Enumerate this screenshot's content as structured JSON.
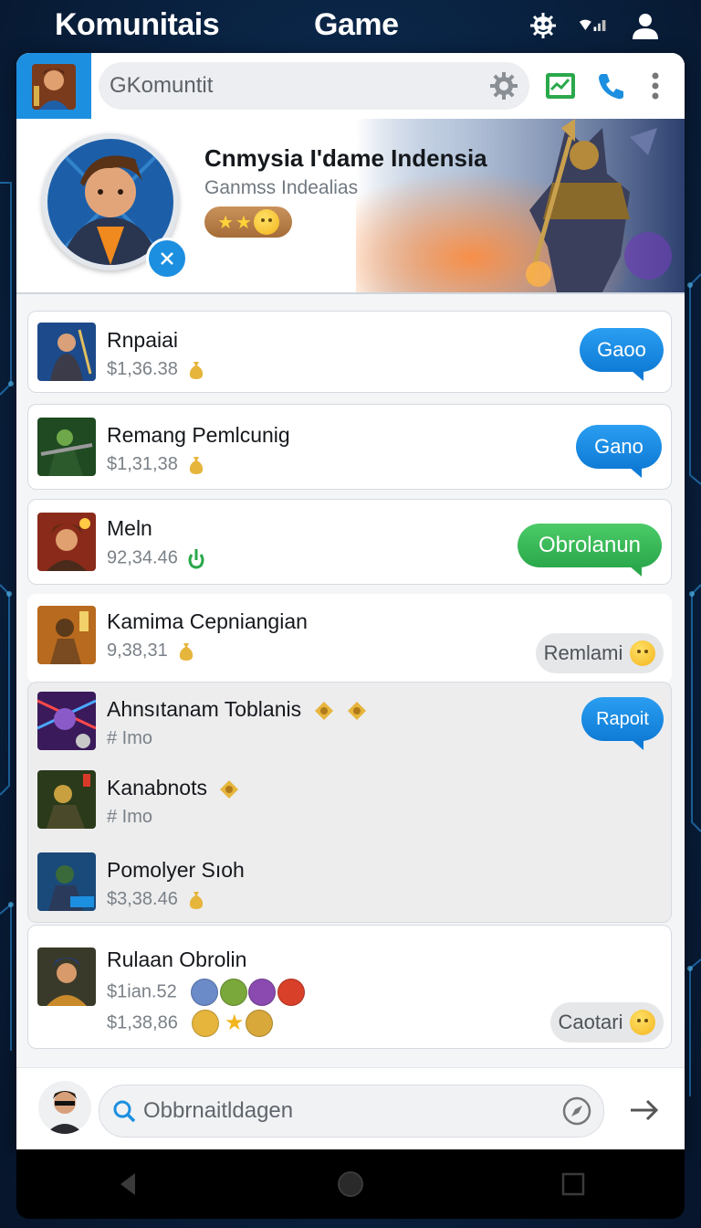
{
  "statusbar": {
    "title_left": "Komunitais",
    "title_right": "Game"
  },
  "appbar": {
    "search_text": "GKomuntit"
  },
  "banner": {
    "title": "Cnmysia I'dame Indensia",
    "subtitle": "Ganmss Indealias"
  },
  "list": [
    {
      "name": "Rnpaiai",
      "sub": "$1,36.38",
      "action": "Gaoo"
    },
    {
      "name": "Remang Pemlcunig",
      "sub": "$1,31,38",
      "action": "Gano"
    },
    {
      "name": "Meln",
      "sub": "92,34.46",
      "action": "Obrolanun"
    },
    {
      "name": "Kamima Cepniangian",
      "sub": "9,38,31",
      "action": "Remlami"
    }
  ],
  "group": {
    "action": "Rapoit",
    "items": [
      {
        "name": "Ahnsıtanam Toblanis",
        "sub": "# Imo"
      },
      {
        "name": "Kanabnots",
        "sub": "# Imo"
      },
      {
        "name": "Pomolyer Sıoh",
        "sub": "$3,38.46"
      }
    ]
  },
  "last": {
    "name": "Rulaan Obrolin",
    "sub1": "$1ian.52",
    "sub2": "$1,38,86",
    "action": "Caotari"
  },
  "composer": {
    "placeholder": "Obbrnaitldagen"
  },
  "colors": {
    "accent": "#1d8fe0",
    "green": "#2aa84b",
    "background": "#0a2546"
  }
}
